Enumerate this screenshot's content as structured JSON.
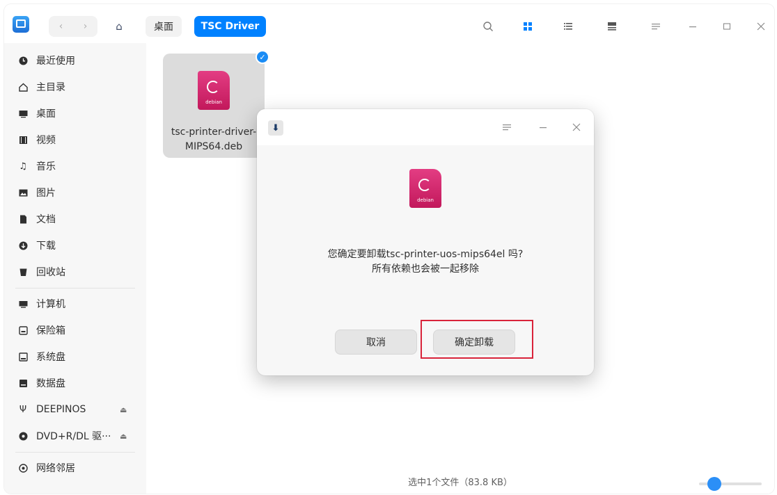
{
  "titlebar": {
    "back_glyph": "‹",
    "forward_glyph": "›",
    "home_glyph": "⌂",
    "breadcrumbs": [
      "桌面",
      "TSC Driver"
    ],
    "icons": {
      "search": "search-icon",
      "icon_view": "grid-view-icon",
      "list_view": "list-view-icon",
      "detail_view": "detail-view-icon",
      "menu": "menu-icon",
      "minimize": "minimize-icon",
      "maximize": "maximize-icon",
      "close": "close-icon"
    },
    "accent": "#0081ff"
  },
  "sidebar": {
    "items": [
      {
        "label": "最近使用",
        "icon": "clock-icon"
      },
      {
        "label": "主目录",
        "icon": "home-icon"
      },
      {
        "label": "桌面",
        "icon": "desktop-icon"
      },
      {
        "label": "视频",
        "icon": "video-icon"
      },
      {
        "label": "音乐",
        "icon": "music-icon"
      },
      {
        "label": "图片",
        "icon": "picture-icon"
      },
      {
        "label": "文档",
        "icon": "document-icon"
      },
      {
        "label": "下载",
        "icon": "download-icon"
      },
      {
        "label": "回收站",
        "icon": "trash-icon"
      },
      {
        "label": "计算机",
        "icon": "computer-icon"
      },
      {
        "label": "保险箱",
        "icon": "vault-icon"
      },
      {
        "label": "系统盘",
        "icon": "disk-icon"
      },
      {
        "label": "数据盘",
        "icon": "disk-icon"
      },
      {
        "label": "DEEPINOS",
        "icon": "usb-icon"
      },
      {
        "label": "DVD+R/DL 驱···",
        "icon": "optical-disc-icon"
      },
      {
        "label": "网络邻居",
        "icon": "network-icon"
      }
    ],
    "eject_glyph": "⏏"
  },
  "main": {
    "file": {
      "name_line1": "tsc-printer-driver-",
      "name_line2": "MIPS64.deb",
      "icon_text": "debian",
      "selected": true
    },
    "status_text": "选中1个文件（83.8 KB）"
  },
  "dialog": {
    "message_line1": "您确定要卸载tsc-printer-uos-mips64el 吗?",
    "message_line2": "所有依赖也会被一起移除",
    "cancel_label": "取消",
    "confirm_label": "确定卸载",
    "icon_text": "debian",
    "highlight_color": "#d9233a"
  }
}
